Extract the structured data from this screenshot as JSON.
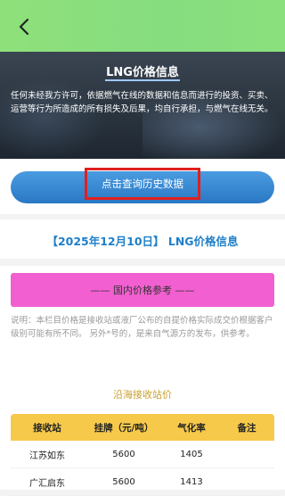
{
  "hero": {
    "title": "LNG价格信息",
    "disclaimer": "任何未经我方许可，依据燃气在线的数据和信息而进行的投资、买卖、运营等行为所造成的所有损失及后果，均自行承担，与燃气在线无关。"
  },
  "query_button": {
    "label": "点击查询历史数据"
  },
  "main": {
    "headline": "【2025年12月10日】 LNG价格信息",
    "domestic_label": "—— 国内价格参考 ——",
    "note": "说明：本栏目价格是接收站或液厂公布的自提价格实际成交价根据客户级别可能有所不同。 另外*号的，是来自气源方的发布，供参考。",
    "section_title": "沿海接收站价"
  },
  "table": {
    "headers": [
      "接收站",
      "挂牌（元/吨）",
      "气化率",
      "备注"
    ],
    "rows": [
      [
        "江苏如东",
        "5600",
        "1405",
        ""
      ],
      [
        "广汇启东",
        "5600",
        "1413",
        ""
      ]
    ]
  },
  "colors": {
    "topbar": "#8ee07a",
    "accent_blue": "#1f7fc8",
    "pink_banner": "#f25fd0",
    "table_header": "#f7c94a",
    "section_gold": "#c8a030",
    "highlight_border": "#e02020"
  },
  "icons": {
    "back": "chevron-left-icon"
  }
}
